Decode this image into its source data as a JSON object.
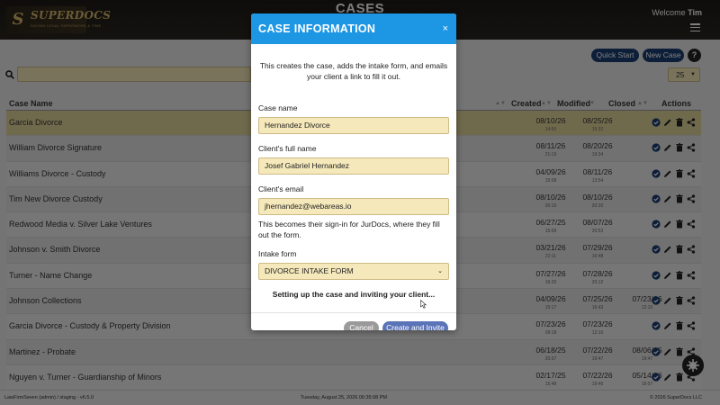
{
  "header": {
    "logo_text": "SUPERDOCS",
    "logo_tagline": "SAVING LEGAL PAPERWORK & TIME",
    "title": "CASES",
    "welcome_prefix": "Welcome",
    "user_name": "Tim"
  },
  "toolbar": {
    "quick_start_label": "Quick Start",
    "new_case_label": "New Case",
    "help_label": "?",
    "search_value": "",
    "page_size": "25"
  },
  "table": {
    "columns": {
      "name": "Case Name",
      "created": "Created",
      "modified": "Modified",
      "closed": "Closed",
      "actions": "Actions"
    },
    "rows": [
      {
        "name": "Garcia Divorce",
        "created": "08/10/26",
        "created_time": "14:50",
        "modified": "08/25/26",
        "modified_time": "15:32",
        "closed": "",
        "closed_time": ""
      },
      {
        "name": "William Divorce Signature",
        "created": "08/11/26",
        "created_time": "21:19",
        "modified": "08/20/26",
        "modified_time": "19:34",
        "closed": "",
        "closed_time": ""
      },
      {
        "name": "Williams Divorce - Custody",
        "created": "04/09/26",
        "created_time": "15:08",
        "modified": "08/11/26",
        "modified_time": "13:54",
        "closed": "",
        "closed_time": ""
      },
      {
        "name": "Tim New Divorce Custody",
        "created": "08/10/26",
        "created_time": "20:10",
        "modified": "08/10/26",
        "modified_time": "20:20",
        "closed": "",
        "closed_time": ""
      },
      {
        "name": "Redwood Media v. Silver Lake Ventures",
        "created": "06/27/25",
        "created_time": "15:08",
        "modified": "08/07/26",
        "modified_time": "20:53",
        "closed": "",
        "closed_time": ""
      },
      {
        "name": "Johnson v. Smith Divorce",
        "created": "03/21/26",
        "created_time": "22:11",
        "modified": "07/29/26",
        "modified_time": "16:48",
        "closed": "",
        "closed_time": ""
      },
      {
        "name": "Turner - Name Change",
        "created": "07/27/26",
        "created_time": "16:35",
        "modified": "07/28/26",
        "modified_time": "20:12",
        "closed": "",
        "closed_time": ""
      },
      {
        "name": "Johnson Collections",
        "created": "04/09/26",
        "created_time": "15:17",
        "modified": "07/25/26",
        "modified_time": "16:43",
        "closed": "07/23/26",
        "closed_time": "12:10"
      },
      {
        "name": "Garcia Divorce - Custody & Property Division",
        "created": "07/23/26",
        "created_time": "09:18",
        "modified": "07/23/26",
        "modified_time": "12:10",
        "closed": "",
        "closed_time": ""
      },
      {
        "name": "Martinez - Probate",
        "created": "06/18/25",
        "created_time": "20:37",
        "modified": "07/22/26",
        "modified_time": "19:47",
        "closed": "08/06/25",
        "closed_time": "19:47"
      },
      {
        "name": "Nguyen v. Turner - Guardianship of Minors",
        "created": "02/17/25",
        "created_time": "15:48",
        "modified": "07/22/26",
        "modified_time": "19:46",
        "closed": "05/14/26",
        "closed_time": "19:07"
      }
    ]
  },
  "footer": {
    "left": "LawFirmSeven (admin) / staging - v6.5.0",
    "center": "Tuesday, August 25, 2026 06:35:08 PM",
    "right": "© 2026 SuperDocs LLC"
  },
  "modal": {
    "title": "CASE INFORMATION",
    "close": "×",
    "intro": "This creates the case, adds the intake form, and emails your client a link to fill it out.",
    "case_name_label": "Case name",
    "case_name_value": "Hernandez Divorce",
    "client_name_label": "Client's full name",
    "client_name_value": "Josef Gabriel Hernandez",
    "client_email_label": "Client's email",
    "client_email_value": "jhernandez@webareas.io",
    "email_help": "This becomes their sign-in for JurDocs, where they fill out the form.",
    "intake_label": "Intake form",
    "intake_value": "DIVORCE INTAKE FORM",
    "status": "Setting up the case and inviting your client...",
    "cancel_label": "Cancel",
    "create_label": "Create and Invite"
  },
  "colors": {
    "header_bg": "#1c1a16",
    "accent_blue": "#1d96e4",
    "button_navy": "#1a3c73",
    "selected_row": "#e0d49a",
    "input_yellow": "#f5e9bb"
  },
  "icons": [
    "search-icon",
    "chevron-down-icon",
    "hamburger-icon",
    "check-circle-icon",
    "pencil-icon",
    "trash-icon",
    "share-icon",
    "close-icon",
    "chat-icon",
    "cursor-icon"
  ]
}
